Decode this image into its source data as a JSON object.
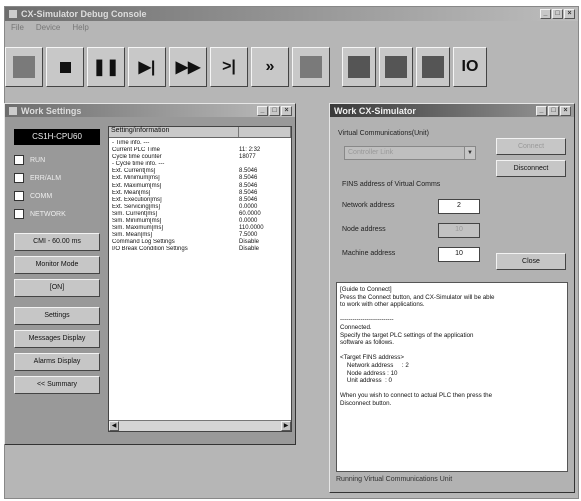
{
  "app": {
    "title": "CX-Simulator Debug Console",
    "menu": [
      "File",
      "Device",
      "Help"
    ],
    "toolbar": [
      {
        "name": "mode-button",
        "glyph": "",
        "icon": "mode-icon"
      },
      {
        "name": "stop-button",
        "glyph": "",
        "icon": "stop-icon"
      },
      {
        "name": "pause-button",
        "glyph": "❚❚",
        "icon": "pause-icon"
      },
      {
        "name": "step-button",
        "glyph": "▶|",
        "icon": "step-icon"
      },
      {
        "name": "continuous-step-button",
        "glyph": "▶▶",
        "icon": "fast-forward-icon"
      },
      {
        "name": "scan-step-button",
        "glyph": ">|",
        "icon": "scan-step-icon"
      },
      {
        "name": "continuous-scan-button",
        "glyph": "»",
        "icon": "continuous-scan-icon"
      },
      {
        "name": "run-button",
        "glyph": "",
        "icon": "run-icon"
      },
      {
        "name": "connect-button",
        "glyph": "",
        "icon": "connect-icon"
      },
      {
        "name": "window-button",
        "glyph": "",
        "icon": "window-icon"
      },
      {
        "name": "notes-button",
        "glyph": "",
        "icon": "notes-icon"
      },
      {
        "name": "io-button",
        "glyph": "IO",
        "icon": "io-icon"
      }
    ]
  },
  "status_window": {
    "title": "Work Settings",
    "cpu": "CS1H-CPU60",
    "leds": [
      "RUN",
      "ERR/ALM",
      "COMM",
      "NETWORK"
    ],
    "buttons": [
      "CMI - 60.00 ms",
      "Monitor Mode",
      "[ON]",
      "Settings",
      "Messages Display",
      "Alarms Display",
      "<< Summary"
    ],
    "columns": [
      "Setting/information",
      ""
    ],
    "rows": [
      [
        "- Time info. ---",
        ""
      ],
      [
        "Current PLC Time",
        "11: 2:32"
      ],
      [
        "Cycle time counter",
        "18077"
      ],
      [
        "- Cycle time info. ---",
        ""
      ],
      [
        "Ext. Current[ms]",
        "8.5046"
      ],
      [
        "Ext. Minimum[ms]",
        "8.5046"
      ],
      [
        "Ext. Maximum[ms]",
        "8.5046"
      ],
      [
        "Ext. Mean[ms]",
        "8.5046"
      ],
      [
        "Ext. Execution[ms]",
        "8.5046"
      ],
      [
        "Ext. Servicing[ms]",
        "0.0000"
      ],
      [
        "Sim. Current[ms]",
        "60.0000"
      ],
      [
        "Sim. Minimum[ms]",
        "0.0000"
      ],
      [
        "Sim. Maximum[ms]",
        "110.0000"
      ],
      [
        "Sim. Mean[ms]",
        "7.5000"
      ],
      [
        "Command Log Settings",
        "Disable"
      ],
      [
        "I/O Break Condition Settings",
        "Disable"
      ]
    ]
  },
  "sim_window": {
    "title": "Work CX-Simulator",
    "vc_label": "Virtual Communications(Unit)",
    "combo_value": "Controller Link",
    "fins_label": "FINS address of Virtual Comms",
    "network_label": "Network address",
    "network_value": "2",
    "node_label": "Node address",
    "node_value": "10",
    "machine_label": "Machine address",
    "machine_value": "10",
    "connect": "Connect",
    "disconnect": "Disconnect",
    "close": "Close",
    "message": "[Guide to Connect]\nPress the Connect button, and CX-Simulator will be able\nto work with other applications.\n\n--------------------------\nConnected.\nSpecify the target PLC settings of the application\nsoftware as follows.\n\n<Target FINS address>\n    Network address     : 2\n    Node address : 10\n    Unit address  : 0\n\nWhen you wish to connect to actual PLC then press the\nDisconnect button.",
    "status": "Running Virtual Communications Unit"
  },
  "colors": {
    "titlebar_active": "#3a3a3a",
    "window_bg": "#b6b6b6",
    "cpu_bg": "#000000"
  }
}
